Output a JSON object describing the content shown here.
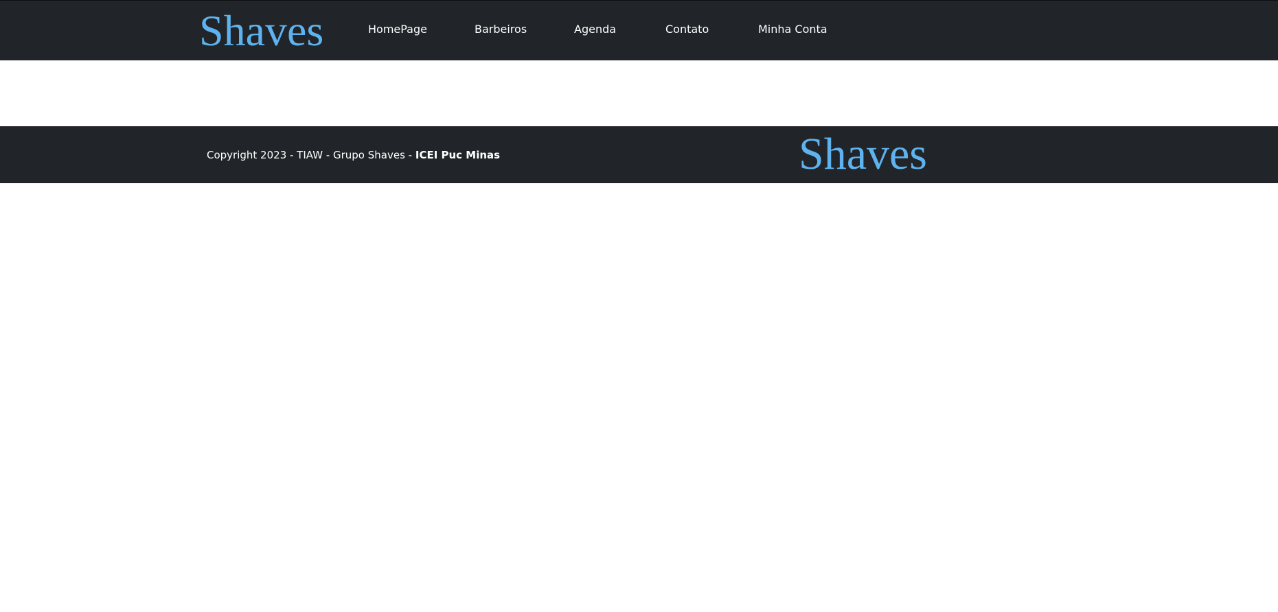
{
  "header": {
    "brand": "Shaves",
    "nav": [
      {
        "label": "HomePage"
      },
      {
        "label": "Barbeiros"
      },
      {
        "label": "Agenda"
      },
      {
        "label": "Contato"
      },
      {
        "label": "Minha Conta"
      }
    ]
  },
  "footer": {
    "copyright_text": "Copyright 2023 - TIAW - Grupo Shaves - ",
    "institution": "ICEI Puc Minas",
    "brand": "Shaves"
  },
  "colors": {
    "bar_background": "#212529",
    "brand": "#5eb3ef",
    "page_background": "#ffffff"
  }
}
